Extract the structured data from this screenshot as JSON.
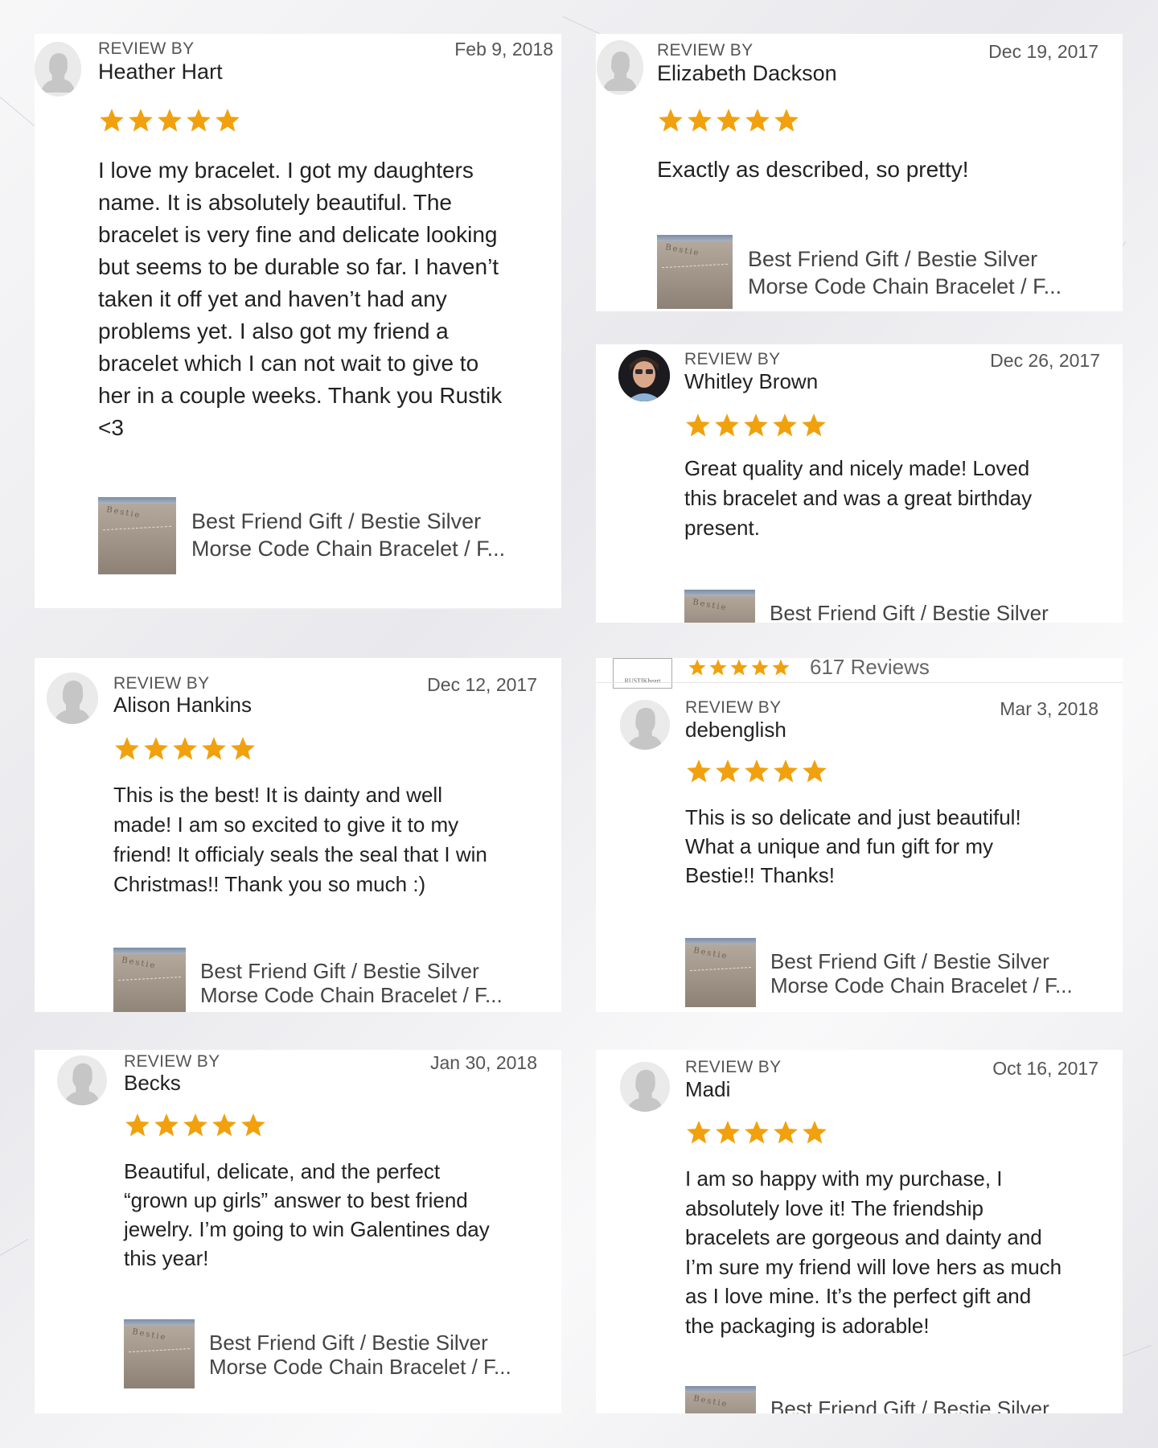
{
  "review_by_label": "REVIEW BY",
  "star_color": "#f1a10d",
  "icons": {
    "avatar": "default-user-avatar-icon",
    "star": "star-icon"
  },
  "product_title_line1": "Best Friend Gift / Bestie Silver",
  "product_title_line2": "Morse Code Chain Bracelet / F...",
  "thumbnail_word": "Bestie",
  "shop_summary": {
    "logo_text": "RUSTIKheart",
    "rating": 5,
    "review_count": "617 Reviews"
  },
  "reviews": [
    {
      "reviewer": "Heather Hart",
      "date": "Feb 9, 2018",
      "rating": 5,
      "text": "I love my bracelet. I got my daughters\nname. It is absolutely beautiful.  The\nbracelet is very fine and delicate looking\nbut seems to be durable so far. I haven’t\ntaken it off yet and haven’t had any\nproblems yet.  I also got my friend a\nbracelet which I can not wait to give to\nher in a couple weeks.   Thank you Rustik\n<3"
    },
    {
      "reviewer": "Elizabeth Dackson",
      "date": "Dec 19, 2017",
      "rating": 5,
      "text": "Exactly as described, so pretty!"
    },
    {
      "reviewer": "Whitley Brown",
      "date": "Dec 26, 2017",
      "rating": 5,
      "text": "Great quality and nicely made! Loved\nthis bracelet and was a great birthday\npresent."
    },
    {
      "reviewer": "Alison Hankins",
      "date": "Dec 12, 2017",
      "rating": 5,
      "text": "This is the best! It is dainty and well\nmade! I am so excited to give it to my\nfriend! It officialy seals the seal that I win\nChristmas!! Thank you so much :)"
    },
    {
      "reviewer": "debenglish",
      "date": "Mar 3, 2018",
      "rating": 5,
      "text": "This is so delicate and just beautiful!\nWhat a unique and fun gift for my\nBestie!!  Thanks!"
    },
    {
      "reviewer": "Becks",
      "date": "Jan 30, 2018",
      "rating": 5,
      "text": "Beautiful, delicate, and the perfect\n“grown up girls” answer to best friend\njewelry. I’m going to win Galentines day\nthis year!"
    },
    {
      "reviewer": "Madi",
      "date": "Oct 16, 2017",
      "rating": 5,
      "text": "I am so happy with my purchase, I\nabsolutely love it! The friendship\nbracelets are gorgeous and dainty and\nI’m sure my friend will love hers as much\nas I love mine. It’s the perfect gift and\nthe packaging is adorable!"
    }
  ]
}
